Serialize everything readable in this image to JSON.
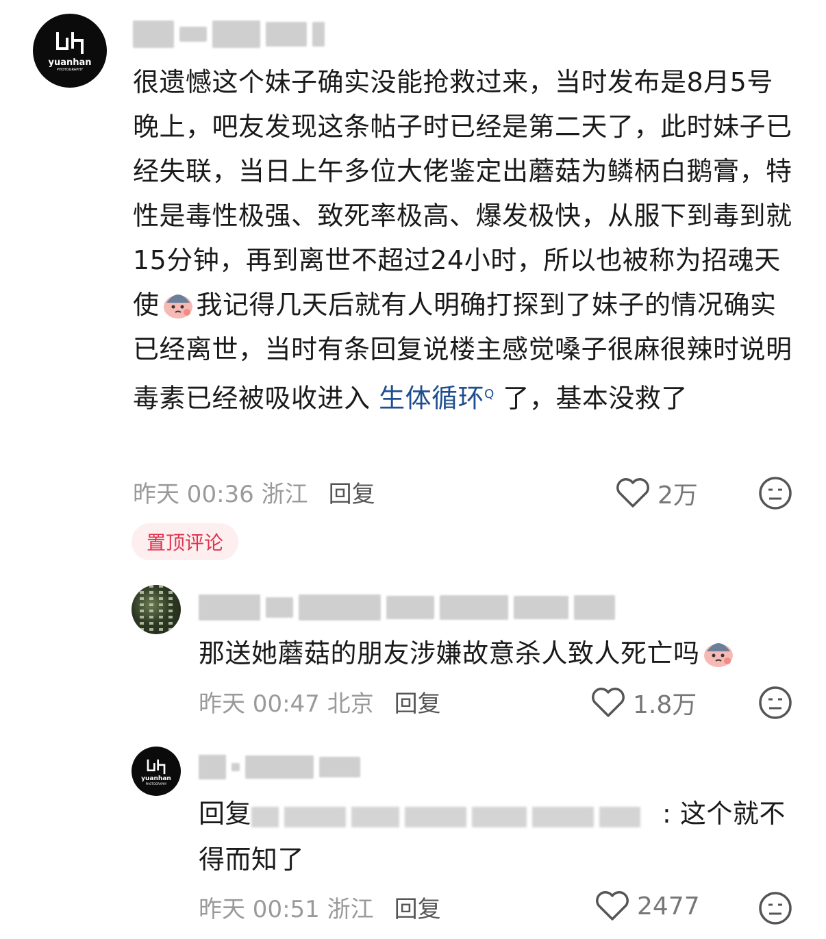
{
  "comments": [
    {
      "avatar_text": "yuanhan",
      "avatar_sub": "PHOTOGRAPHY",
      "text_before_link": "很遗憾这个妹子确实没能抢救过来，当时发布是8月5号晚上，吧友发现这条帖子时已经是第二天了，此时妹子已经失联，当日上午多位大佬鉴定出蘑菇为鳞柄白鹅膏，特性是毒性极强、致死率极高、爆发极快，从服下到毒到就15分钟，再到离世不超过24小时，所以也被称为招魂天使",
      "text_after_emoji": "我记得几天后就有人明确打探到了妹子的情况确实已经离世，当时有条回复说楼主感觉嗓子很麻很辣时说明毒素已经被吸收进入 ",
      "link": "生体循环",
      "text_after_link": " 了，基本没救了",
      "time": "昨天 00:36 浙江",
      "reply": "回复",
      "likes": "2万",
      "badge": "置顶评论"
    },
    {
      "text": "那送她蘑菇的朋友涉嫌故意杀人致人死亡吗",
      "time": "昨天 00:47 北京",
      "reply": "回复",
      "likes": "1.8万"
    },
    {
      "avatar_text": "yuanhan",
      "avatar_sub": "PHOTOGRAPHY",
      "reply_prefix": "回复",
      "text": ": 这个就不得而知了",
      "time": "昨天 00:51 浙江",
      "reply": "回复",
      "likes": "2477"
    }
  ],
  "icons": {
    "like": "heart-outline-icon",
    "dislike": "meh-face-icon",
    "emoji": "crying-emoji-icon"
  },
  "colors": {
    "link": "#1f4e8f",
    "badge_bg": "#fdeef0",
    "badge_text": "#e0344e"
  }
}
